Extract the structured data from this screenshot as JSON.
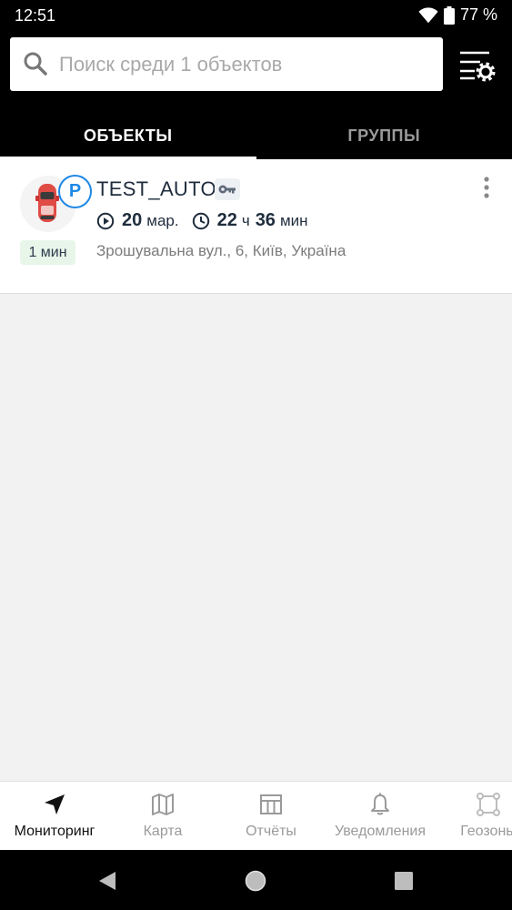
{
  "status_bar": {
    "time": "12:51",
    "battery": "77 %"
  },
  "search": {
    "placeholder": "Поиск среди 1 объектов",
    "value": ""
  },
  "tabs": [
    {
      "label": "ОБЪЕКТЫ",
      "active": true
    },
    {
      "label": "ГРУППЫ",
      "active": false
    }
  ],
  "objects": [
    {
      "name": "TEST_AUTO",
      "state": "P",
      "duration": "1 мин",
      "date_day": "20",
      "date_month": "мар.",
      "time_hours": "22",
      "time_h_unit": "ч",
      "time_minutes": "36",
      "time_m_unit": "мин",
      "address": "Зрошувальна вул., 6, Київ, Україна"
    }
  ],
  "bottom_nav": [
    {
      "label": "Мониторинг",
      "icon": "navigation-arrow-icon",
      "active": true
    },
    {
      "label": "Карта",
      "icon": "map-icon",
      "active": false
    },
    {
      "label": "Отчёты",
      "icon": "reports-icon",
      "active": false
    },
    {
      "label": "Уведомления",
      "icon": "bell-icon",
      "active": false
    },
    {
      "label": "Геозоны",
      "icon": "geozone-icon",
      "active": false
    }
  ],
  "colors": {
    "accent": "#1e88e5",
    "badge_bg": "#e8f5e9",
    "text": "#1f2d3d"
  }
}
